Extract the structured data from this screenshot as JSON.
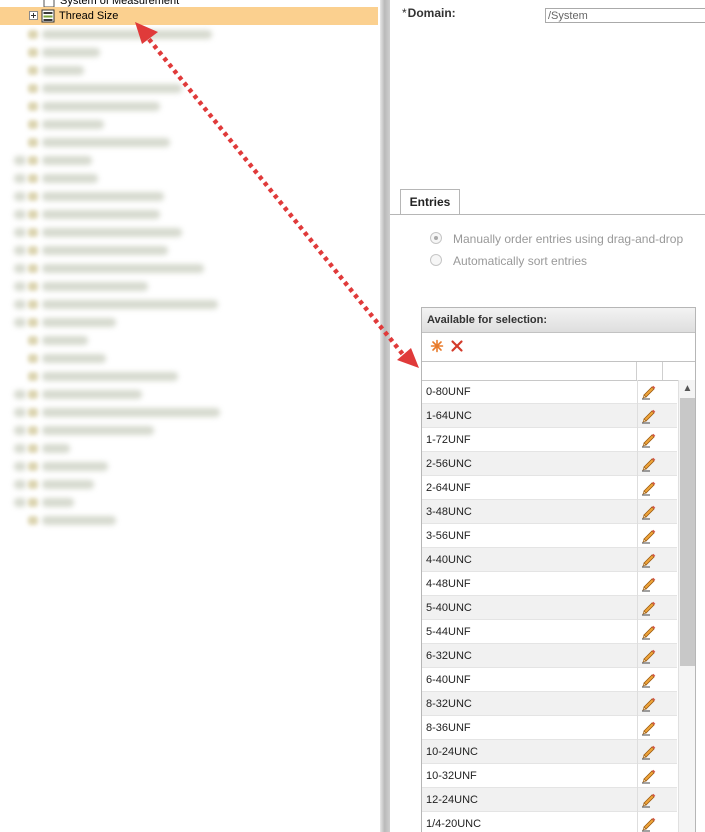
{
  "tree": {
    "partial_item_label": "System of Measurement",
    "selected_item_label": "Thread Size"
  },
  "form": {
    "domain_label": "Domain:",
    "required_marker": "*",
    "domain_value": "/System"
  },
  "tabs": [
    {
      "label": "Entries",
      "active": true
    }
  ],
  "sort_options": [
    {
      "label": "Manually order entries using drag-and-drop",
      "checked": true,
      "enabled": false
    },
    {
      "label": "Automatically sort entries",
      "checked": false,
      "enabled": false
    }
  ],
  "available_list": {
    "header": "Available for selection:",
    "toolbar": {
      "add_icon": "asterisk-icon",
      "delete_icon": "red-x-icon"
    },
    "entries": [
      "0-80UNF",
      "1-64UNC",
      "1-72UNF",
      "2-56UNC",
      "2-64UNF",
      "3-48UNC",
      "3-56UNF",
      "4-40UNC",
      "4-48UNF",
      "5-40UNC",
      "5-44UNF",
      "6-32UNC",
      "6-40UNF",
      "8-32UNC",
      "8-36UNF",
      "10-24UNC",
      "10-32UNF",
      "12-24UNC",
      "1/4-20UNC"
    ],
    "row_edit_icon": "pencil-icon"
  },
  "annotation": {
    "arrow_color": "#e03a3a",
    "style": "dotted double-headed arrow"
  },
  "colors": {
    "selected_row": "#fbd08f",
    "accent_orange": "#e87a2a"
  }
}
